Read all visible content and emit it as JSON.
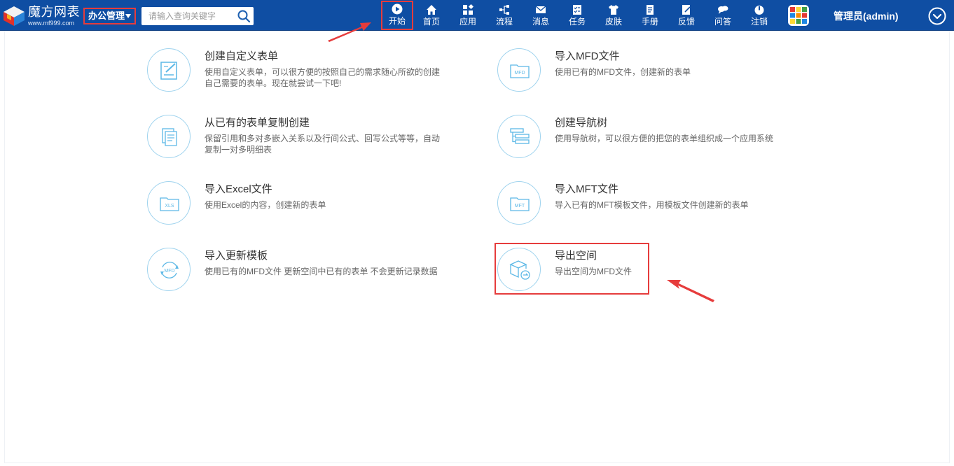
{
  "header": {
    "logo_title": "魔方网表",
    "logo_url": "www.mf999.com",
    "app_selector": "办公管理",
    "search_placeholder": "请输入查询关键字",
    "nav": [
      {
        "label": "开始",
        "icon": "play-icon",
        "active": true
      },
      {
        "label": "首页",
        "icon": "home-icon"
      },
      {
        "label": "应用",
        "icon": "apps-icon"
      },
      {
        "label": "流程",
        "icon": "flow-icon"
      },
      {
        "label": "消息",
        "icon": "mail-icon"
      },
      {
        "label": "任务",
        "icon": "task-icon"
      },
      {
        "label": "皮肤",
        "icon": "shirt-icon"
      },
      {
        "label": "手册",
        "icon": "manual-icon"
      },
      {
        "label": "反馈",
        "icon": "feedback-icon"
      },
      {
        "label": "问答",
        "icon": "qa-icon"
      },
      {
        "label": "注销",
        "icon": "power-icon"
      }
    ],
    "user_name": "管理员(admin)"
  },
  "cards": [
    {
      "title": "创建自定义表单",
      "desc": "使用自定义表单，可以很方便的按照自己的需求随心所欲的创建自己需要的表单。现在就尝试一下吧!",
      "icon": "edit-form-icon"
    },
    {
      "title": "导入MFD文件",
      "desc": "使用已有的MFD文件，创建新的表单",
      "icon": "mfd-folder-icon"
    },
    {
      "title": "从已有的表单复制创建",
      "desc": "保留引用和多对多嵌入关系以及行间公式、回写公式等等，自动复制一对多明细表",
      "icon": "copy-doc-icon"
    },
    {
      "title": "创建导航树",
      "desc": "使用导航树，可以很方便的把您的表单组织成一个应用系统",
      "icon": "nav-tree-icon"
    },
    {
      "title": "导入Excel文件",
      "desc": "使用Excel的内容，创建新的表单",
      "icon": "xls-folder-icon"
    },
    {
      "title": "导入MFT文件",
      "desc": "导入已有的MFT模板文件，用模板文件创建新的表单",
      "icon": "mft-folder-icon"
    },
    {
      "title": "导入更新模板",
      "desc": "使用已有的MFD文件 更新空间中已有的表单 不会更新记录数据",
      "icon": "mfd-refresh-icon"
    },
    {
      "title": "导出空间",
      "desc": "导出空间为MFD文件",
      "icon": "export-box-icon"
    }
  ],
  "icon_text": {
    "mfd": "MFD",
    "xls": "XLS",
    "mft": "MFT"
  },
  "colors": {
    "header_bg": "#0f4ea3",
    "highlight": "#e63c3c",
    "icon_line": "#5cb8e6"
  }
}
